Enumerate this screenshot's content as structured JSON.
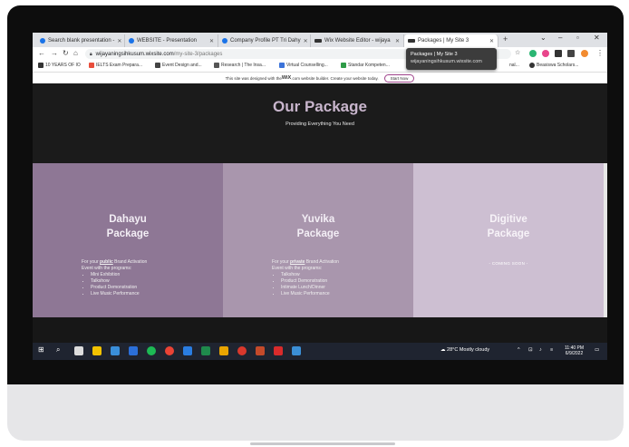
{
  "browser": {
    "tabs": [
      {
        "label": "Search blank presentation - ",
        "color": "#1a73e8"
      },
      {
        "label": "WEBSITE - Presentation",
        "color": "#1a73e8"
      },
      {
        "label": "Company Profile PT Tri Dahy",
        "color": "#1a73e8"
      },
      {
        "label": "Wix Website Editor - wijaya",
        "color": "#333333"
      },
      {
        "label": "Packages | My Site 3",
        "color": "#333333"
      }
    ],
    "new_tab": "+",
    "url_host": "wijayaningsihkusum.wixsite.com",
    "url_path": "/my-site-3/packages",
    "bookmarks": [
      {
        "label": "10 YEARS OF IO",
        "color": "#333333"
      },
      {
        "label": "IELTS Exam Prepara...",
        "color": "#e94e3c"
      },
      {
        "label": "Event Design and...",
        "color": "#444444"
      },
      {
        "label": "Research | The Insa...",
        "color": "#555555"
      },
      {
        "label": "Virtual Counselling...",
        "color": "#3b73d9"
      },
      {
        "label": "Standar Kompeten...",
        "color": "#2e9b47"
      },
      {
        "label": "nal...",
        "color": "#888888"
      },
      {
        "label": "Beasiswa Scholars...",
        "color": "#333333"
      }
    ],
    "tooltip_title": "Packages | My Site 3",
    "tooltip_url": "wijayaningsihkusum.wixsite.com"
  },
  "wix_banner": {
    "text_before": "This site was designed with the ",
    "brand": "WiX",
    "text_after": ".com website builder. Create your website today.",
    "button": "Start Now"
  },
  "page": {
    "title": "Our Package",
    "subtitle": "Providing Everything You Need",
    "cards": [
      {
        "title_line1": "Dahayu",
        "title_line2": "Package",
        "intro_pre": "For your ",
        "intro_keyword": "public",
        "intro_post": " Brand Activation",
        "intro_line2": "Event with the programs:",
        "items": [
          "Mini Exhibition",
          "Talkshow",
          "Product Demonstration",
          "Live Music Performance"
        ],
        "bg": "#8e7795"
      },
      {
        "title_line1": "Yuvika",
        "title_line2": "Package",
        "intro_pre": "For your ",
        "intro_keyword": "private",
        "intro_post": " Brand Activation",
        "intro_line2": "Event with the programs:",
        "items": [
          "Talkshow",
          "Product Demonstration",
          "Intimate Lunch/Dinner",
          "Live Music Performance"
        ],
        "bg": "#a996ad"
      },
      {
        "title_line1": "Digitive",
        "title_line2": "Package",
        "coming_soon": "- COMING SOON -",
        "bg": "#cdbfd2"
      }
    ]
  },
  "taskbar": {
    "weather": "28°C  Mostly cloudy",
    "time": "11:40 PM",
    "date": "6/9/2022"
  },
  "colors": {
    "accent": "#c8b5cc",
    "page_bg": "#1b1b1b"
  }
}
